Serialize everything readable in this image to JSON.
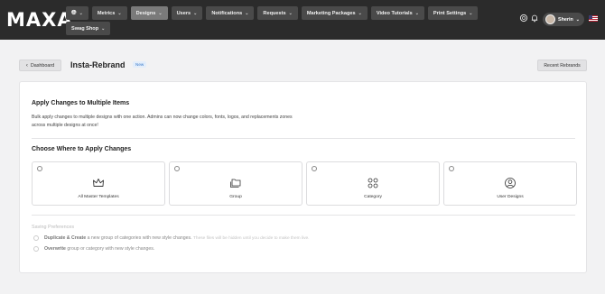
{
  "brand": {
    "logo_text": "MAXA"
  },
  "nav": {
    "items": [
      {
        "label": "",
        "icon": "globe-icon"
      },
      {
        "label": "Metrics"
      },
      {
        "label": "Designs",
        "active": true
      },
      {
        "label": "Users"
      },
      {
        "label": "Notifications"
      },
      {
        "label": "Requests"
      },
      {
        "label": "Marketing Packages"
      },
      {
        "label": "Video Tutorials"
      },
      {
        "label": "Print Settings"
      },
      {
        "label": "Swag Shop"
      }
    ]
  },
  "user": {
    "name": "Sherin",
    "language_flag": "us-flag-icon"
  },
  "header": {
    "back_label": "Dashboard",
    "title": "Insta-Rebrand",
    "badge": "New",
    "recent_label": "Recent Rebrands"
  },
  "section1": {
    "title": "Apply Changes to Multiple Items",
    "description": "Bulk apply changes to multiple designs with one action. Admins can now change colors, fonts, logos, and replacements zones across multiple designs at once!"
  },
  "section2": {
    "title": "Choose Where to Apply Changes",
    "options": [
      {
        "label": "All Master Templates",
        "icon": "crown-icon"
      },
      {
        "label": "Group",
        "icon": "folders-icon"
      },
      {
        "label": "Category",
        "icon": "grid-circles-icon"
      },
      {
        "label": "User Designs",
        "icon": "user-circle-icon"
      }
    ]
  },
  "preferences": {
    "title": "Saving Preferences",
    "option1_bold": "Duplicate & Create",
    "option1_text": "a new group of categories with new style changes.",
    "option1_note": "These files will be hidden until you decide to make them live.",
    "option2_bold": "Overwrite",
    "option2_text": "group or category with new style changes."
  },
  "colors": {
    "topbar": "#2b2b2b",
    "nav_item": "#4a4a4a",
    "nav_active": "#7a7a7a",
    "badge_text": "#3b7ac9"
  }
}
